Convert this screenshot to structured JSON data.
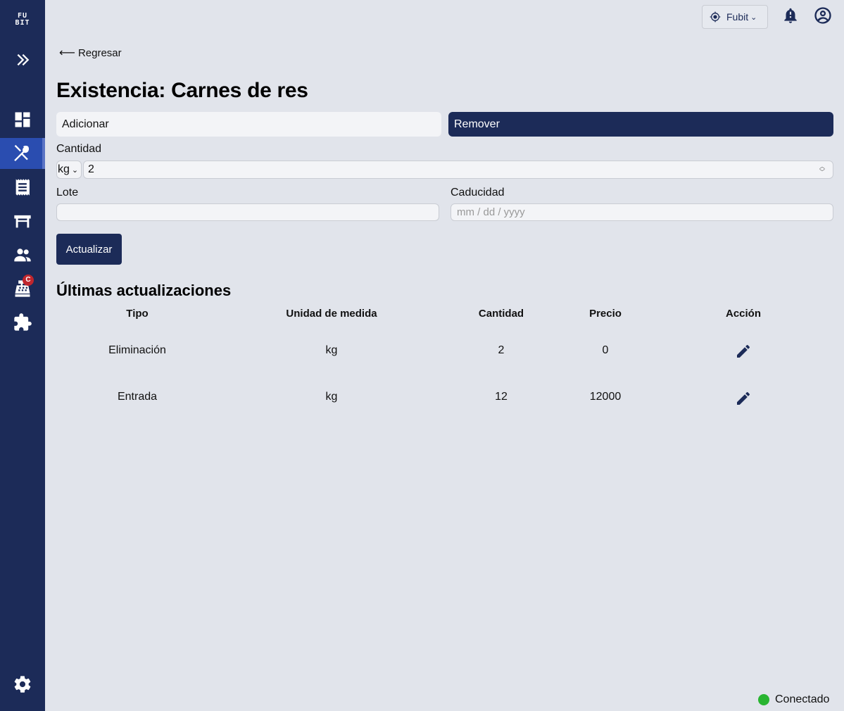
{
  "brand": {
    "logo_line1": "FU",
    "logo_line2": "BIT"
  },
  "sidebar": {
    "items": [
      {
        "name": "dashboard-icon"
      },
      {
        "name": "utensils-icon",
        "active": true
      },
      {
        "name": "receipt-icon"
      },
      {
        "name": "table-icon"
      },
      {
        "name": "people-icon"
      },
      {
        "name": "cash-register-icon",
        "badge": "C"
      },
      {
        "name": "puzzle-icon"
      },
      {
        "name": "gear-icon"
      }
    ]
  },
  "topbar": {
    "location": "Fubit"
  },
  "nav": {
    "back_label": "Regresar"
  },
  "page": {
    "title": "Existencia: Carnes de res"
  },
  "mode": {
    "add_label": "Adicionar",
    "remove_label": "Remover",
    "selected": "Remover"
  },
  "form": {
    "quantity_label": "Cantidad",
    "unit_value": "kg",
    "quantity_value": "2",
    "lot_label": "Lote",
    "lot_value": "",
    "expiry_label": "Caducidad",
    "expiry_placeholder": "mm / dd / yyyy",
    "submit_label": "Actualizar"
  },
  "updates": {
    "title": "Últimas actualizaciones",
    "columns": [
      "Tipo",
      "Unidad de medida",
      "Cantidad",
      "Precio",
      "Acción"
    ],
    "rows": [
      {
        "tipo": "Eliminación",
        "unidad": "kg",
        "cantidad": "2",
        "precio": "0"
      },
      {
        "tipo": "Entrada",
        "unidad": "kg",
        "cantidad": "12",
        "precio": "12000"
      }
    ]
  },
  "status": {
    "label": "Conectado",
    "color": "#29b531"
  },
  "colors": {
    "primary": "#1c2b58",
    "active_nav": "#2a4db0",
    "background": "#e1e4eb"
  }
}
